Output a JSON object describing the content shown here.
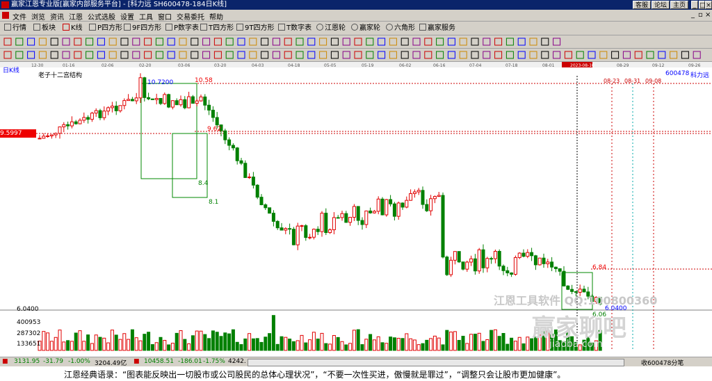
{
  "window": {
    "title": "赢家江恩专业版[赢家内部服务平台] - [科力远  SH600478-184日K线]",
    "buttons": [
      "客服",
      "论坛",
      "主页"
    ]
  },
  "menu": [
    "文件",
    "浏览",
    "资讯",
    "江恩",
    "公式选股",
    "设置",
    "工具",
    "窗口",
    "交易委托",
    "帮助"
  ],
  "toolbar1": [
    "行情",
    "板块",
    "K线",
    "P四方形",
    "9F四方形",
    "P数字表",
    "T四方形",
    "9T四方形",
    "T数字表",
    "江恩轮",
    "赢家轮",
    "六角形",
    "赢家服务"
  ],
  "chart": {
    "period_label": "日K线",
    "study_title": "老子十二宫结构",
    "stock_code": "600478",
    "stock_name": "科力远",
    "date_axis": [
      "12-30",
      "01-16",
      "02-06",
      "02-20",
      "03-06",
      "03-20",
      "04-03",
      "04-18",
      "05-05",
      "05-19",
      "06-02",
      "06-16",
      "07-04",
      "07-18",
      "08-01",
      "2023-08-10",
      "08-29",
      "09-12",
      "09-26"
    ],
    "future_dates": [
      "08-23",
      "08-31",
      "09-08"
    ],
    "price_marker": "9.5997",
    "prices": {
      "peak": "10.7200",
      "p1": "10.58",
      "p2": "9.62",
      "p3": "8.4",
      "p4": "8.1",
      "p5": "6.84",
      "p6": "6.0400",
      "p7": "6.06"
    },
    "watermark1": "江恩工具软件  QQ:100800360",
    "watermark2": "赢家聊吧",
    "watermark3": "jiaoba.com",
    "volume_axis": [
      "6.0400",
      "400953",
      "287302",
      "133651"
    ]
  },
  "status": {
    "sh": "3131.95",
    "sh_change": "-31.79",
    "sh_pct": "-1.00%",
    "sh_vol": "3204.49亿",
    "sz": "10458.51",
    "sz_change": "-186.01",
    "sz_pct": "-1.75%",
    "sz_vol": "4242.",
    "right": "收600478分笔"
  },
  "quote": "江恩经典语录：“图表能反映出一切股市或公司股民的总体心理状况”，“不要一次性买进，傲慢就是罪过”，“调整只会让股市更加健康”。",
  "colors": {
    "up": "#e00000",
    "down": "#008000",
    "accent": "#0a246a"
  }
}
